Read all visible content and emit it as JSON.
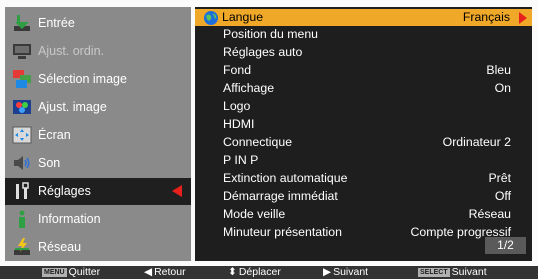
{
  "sidebar": {
    "items": [
      {
        "label": "Entrée",
        "icon": "input-icon",
        "state": "normal"
      },
      {
        "label": "Ajust. ordin.",
        "icon": "computer-adjust-icon",
        "state": "disabled"
      },
      {
        "label": "Sélection image",
        "icon": "image-select-icon",
        "state": "normal"
      },
      {
        "label": "Ajust. image",
        "icon": "image-adjust-icon",
        "state": "normal"
      },
      {
        "label": "Écran",
        "icon": "screen-icon",
        "state": "normal"
      },
      {
        "label": "Son",
        "icon": "speaker-icon",
        "state": "normal"
      },
      {
        "label": "Réglages",
        "icon": "settings-icon",
        "state": "active"
      },
      {
        "label": "Information",
        "icon": "info-icon",
        "state": "normal"
      },
      {
        "label": "Réseau",
        "icon": "network-icon",
        "state": "normal"
      }
    ]
  },
  "menu": {
    "rows": [
      {
        "label": "Langue",
        "value": "Français",
        "selected": true
      },
      {
        "label": "Position du menu",
        "value": ""
      },
      {
        "label": "Réglages auto",
        "value": ""
      },
      {
        "label": "Fond",
        "value": "Bleu"
      },
      {
        "label": "Affichage",
        "value": "On"
      },
      {
        "label": "Logo",
        "value": ""
      },
      {
        "label": "HDMI",
        "value": ""
      },
      {
        "label": "Connectique",
        "value": "Ordinateur 2"
      },
      {
        "label": "P IN P",
        "value": ""
      },
      {
        "label": "Extinction automatique",
        "value": "Prêt"
      },
      {
        "label": "Démarrage immédiat",
        "value": "Off"
      },
      {
        "label": "Mode veille",
        "value": "Réseau"
      },
      {
        "label": "Minuteur présentation",
        "value": "Compte progressif"
      }
    ],
    "page_indicator": "1/2"
  },
  "footer": {
    "items": [
      {
        "key": "MENU",
        "label": "Quitter"
      },
      {
        "glyph": "◀",
        "label": "Retour"
      },
      {
        "glyph": "⬍",
        "label": "Déplacer"
      },
      {
        "glyph": "▶",
        "label": "Suivant"
      },
      {
        "key": "SELECT",
        "label": "Suivant"
      }
    ]
  },
  "colors": {
    "selected_row_bg": "#f0a828",
    "arrow_red": "#e8201c",
    "panel_bg": "#1e1e1e",
    "sidebar_bg": "#8a8a8a"
  }
}
